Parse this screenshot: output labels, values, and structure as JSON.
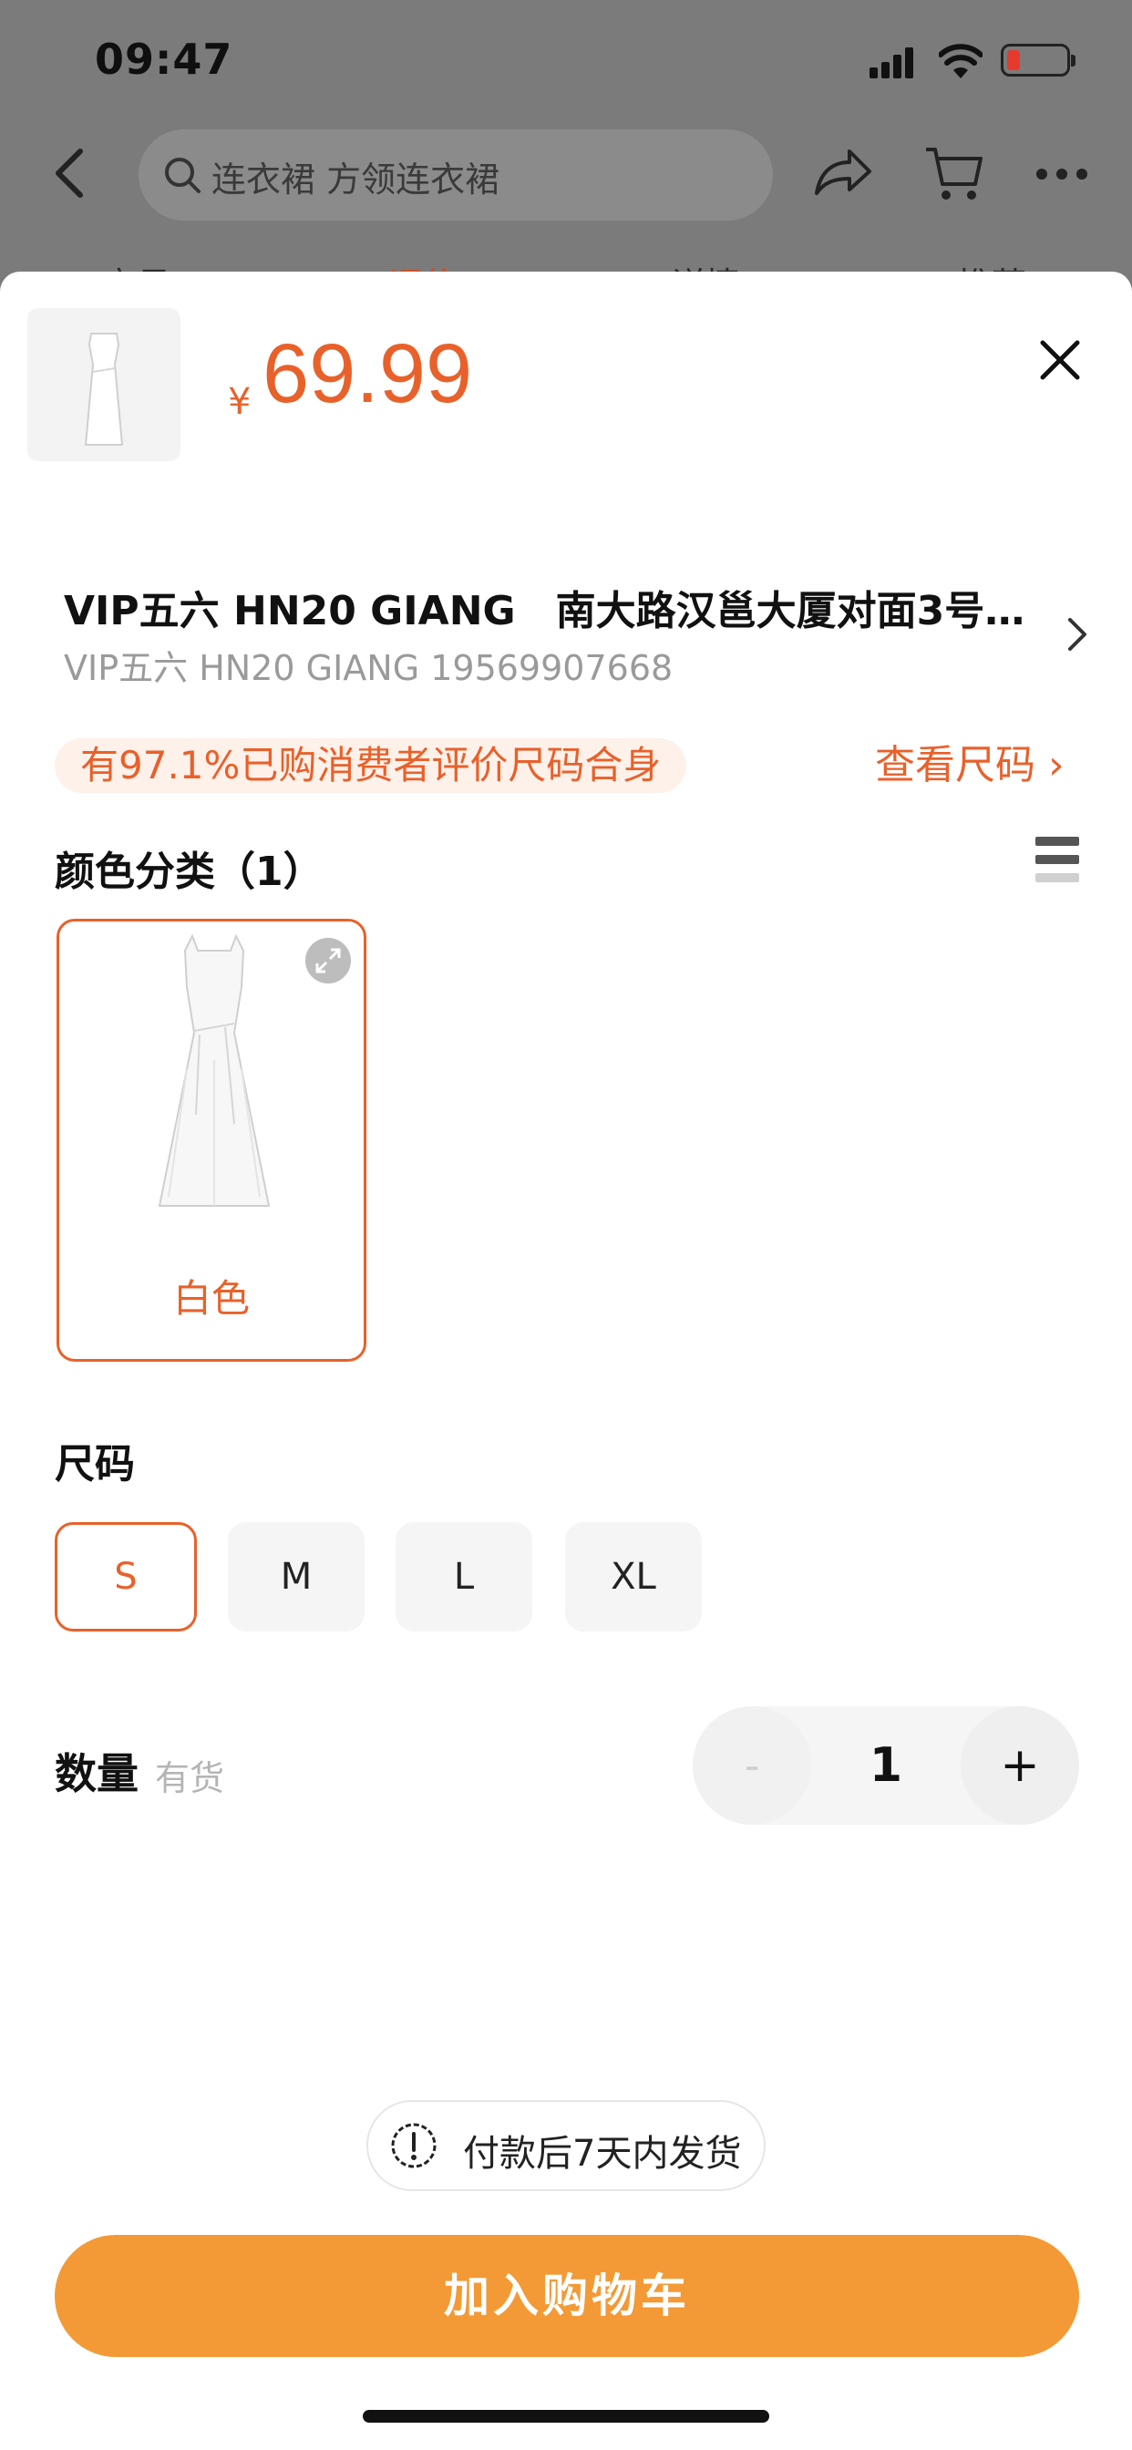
{
  "status_bar": {
    "time": "09:47"
  },
  "top_nav": {
    "search_placeholder": "连衣裙 方领连衣裙",
    "tabs": [
      "宝贝",
      "评价",
      "详情",
      "推荐"
    ]
  },
  "product": {
    "currency_symbol": "¥",
    "price": "69.99"
  },
  "address": {
    "title": "VIP五六 HN20 GIANG　南大路汉邕大厦对面3号…",
    "subtitle": "VIP五六  HN20 GIANG 19569907668"
  },
  "fit": {
    "badge": "有97.1%已购消费者评价尺码合身",
    "size_link": "查看尺码 ›"
  },
  "color_section": {
    "title": "颜色分类（1）",
    "options": [
      {
        "label": "白色",
        "selected": true
      }
    ]
  },
  "size_section": {
    "title": "尺码",
    "options": [
      {
        "label": "S",
        "selected": true
      },
      {
        "label": "M",
        "selected": false
      },
      {
        "label": "L",
        "selected": false
      },
      {
        "label": "XL",
        "selected": false
      }
    ]
  },
  "quantity": {
    "label": "数量",
    "stock": "有货",
    "value": "1",
    "minus": "-",
    "plus": "+"
  },
  "shipping_note": "付款后7天内发货",
  "add_to_cart": "加入购物车",
  "colors": {
    "accent": "#e8612b",
    "cta": "#f39a36"
  }
}
